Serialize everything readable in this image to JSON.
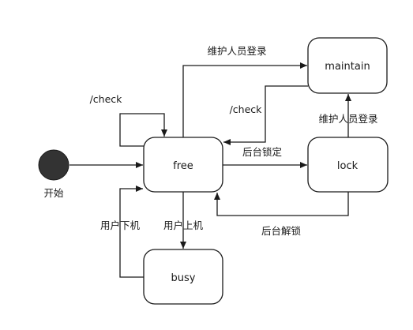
{
  "diagram": {
    "start_label": "开始",
    "states": {
      "free": "free",
      "maintain": "maintain",
      "lock": "lock",
      "busy": "busy"
    },
    "edges": {
      "free_maintain": "维护人员登录",
      "free_self": "/check",
      "maintain_free": "/check",
      "lock_maintain": "维护人员登录",
      "free_lock": "后台锁定",
      "lock_free": "后台解锁",
      "free_busy": "用户上机",
      "busy_free": "用户下机"
    },
    "colors": {
      "stroke": "#1a1a1a",
      "start_fill": "#333333",
      "state_fill": "#ffffff"
    }
  }
}
